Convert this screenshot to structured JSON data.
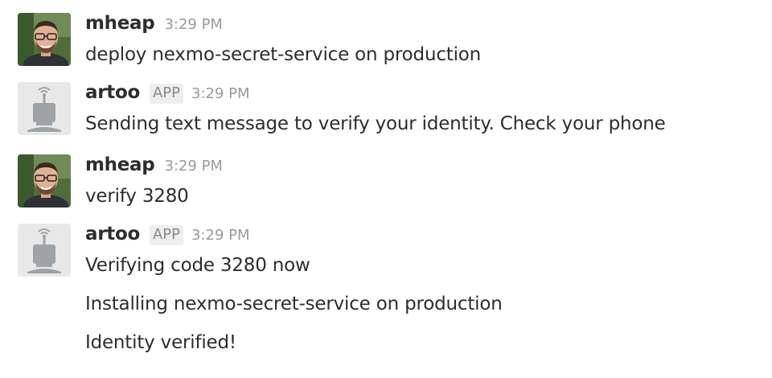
{
  "messages": [
    {
      "sender": "mheap",
      "badge": "",
      "time": "3:29 PM",
      "avatar": "user-photo-avatar",
      "lines": [
        "deploy nexmo-secret-service on production"
      ]
    },
    {
      "sender": "artoo",
      "badge": "APP",
      "time": "3:29 PM",
      "avatar": "robot-avatar",
      "lines": [
        "Sending text message to verify your identity. Check your phone"
      ]
    },
    {
      "sender": "mheap",
      "badge": "",
      "time": "3:29 PM",
      "avatar": "user-photo-avatar",
      "lines": [
        "verify 3280"
      ]
    },
    {
      "sender": "artoo",
      "badge": "APP",
      "time": "3:29 PM",
      "avatar": "robot-avatar",
      "lines": [
        "Verifying code 3280 now",
        "Installing nexmo-secret-service on production",
        "Identity verified!"
      ]
    }
  ],
  "colors": {
    "text": "#2c2d30",
    "timestamp": "#9a9a9a",
    "badge_bg": "#eeeeee",
    "badge_text": "#8a8a8a",
    "robot_bg": "#e8e8e8",
    "robot_body": "#9ea3a8"
  }
}
